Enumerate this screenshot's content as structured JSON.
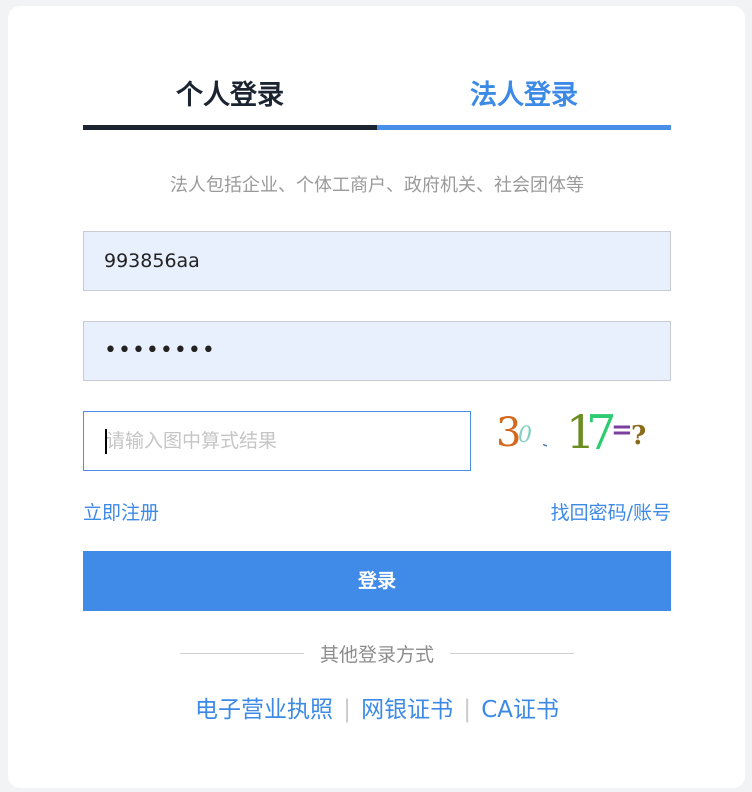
{
  "tabs": [
    {
      "label": "个人登录",
      "active": true
    },
    {
      "label": "法人登录",
      "active": false
    }
  ],
  "hint": "法人包括企业、个体工商户、政府机关、社会团体等",
  "username": {
    "value": "993856aa"
  },
  "password": {
    "masked": "••••••••"
  },
  "captcha": {
    "placeholder": "请输入图中算式结果",
    "text": "30 - 17 = ?"
  },
  "links": {
    "register": "立即注册",
    "recover": "找回密码/账号"
  },
  "login_button": "登录",
  "other_methods": {
    "title": "其他登录方式",
    "items": [
      "电子营业执照",
      "网银证书",
      "CA证书"
    ]
  },
  "colors": {
    "accent": "#408ae8",
    "dark": "#1b2430"
  }
}
